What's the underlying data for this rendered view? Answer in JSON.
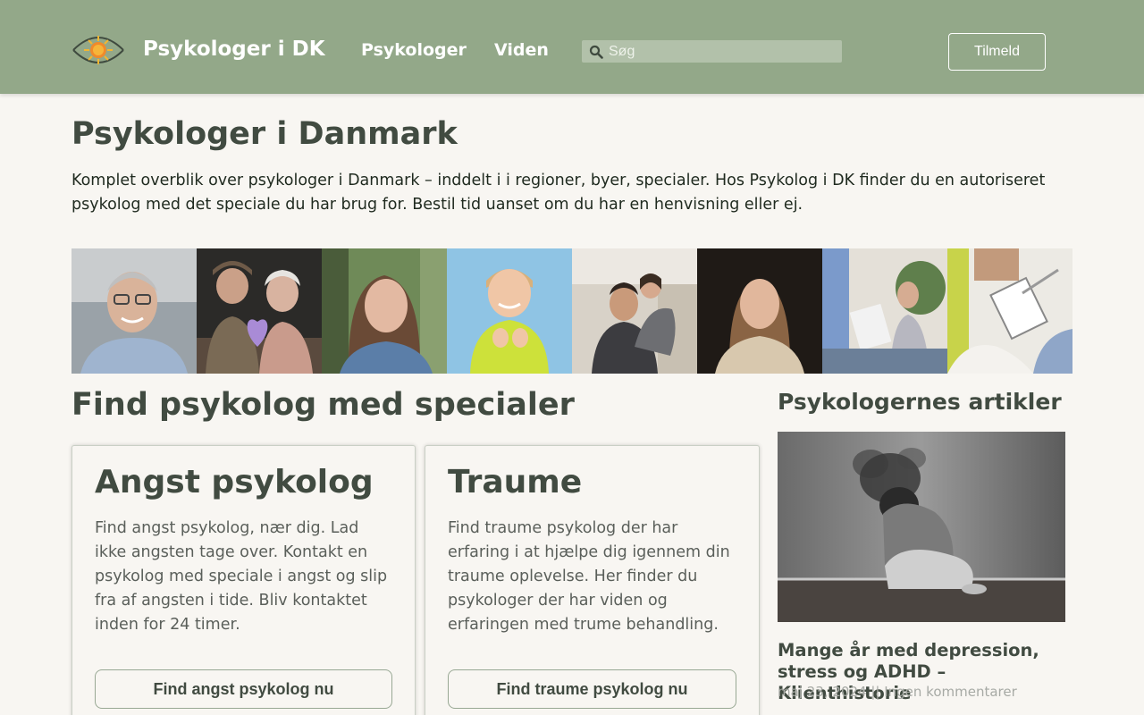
{
  "header": {
    "site_title": "Psykologer i DK",
    "nav": [
      {
        "label": "Psykologer"
      },
      {
        "label": "Viden"
      }
    ],
    "search": {
      "placeholder": "Søg",
      "value": ""
    },
    "signup_label": "Tilmeld"
  },
  "intro": {
    "title": "Psykologer i Danmark",
    "text": "Komplet overblik over psykologer i Danmark – inddelt i i regioner, byer, specialer. Hos Psykolog i DK finder du en autoriseret psykolog med det speciale du har brug for. Bestil tid uanset om du har en henvisning eller ej."
  },
  "photo_strip": [
    {
      "icon": "smiling-older-man-photo"
    },
    {
      "icon": "elderly-couple-heart-balloon-photo"
    },
    {
      "icon": "young-woman-photo"
    },
    {
      "icon": "child-yellow-shirt-photo"
    },
    {
      "icon": "happy-couple-photo"
    },
    {
      "icon": "woman-portrait-photo"
    },
    {
      "icon": "therapy-session-photo"
    },
    {
      "icon": "therapist-clipboard-photo"
    }
  ],
  "specialties": {
    "title": "Find psykolog med specialer",
    "cards": [
      {
        "title": "Angst psykolog",
        "text": "Find angst psykolog, nær dig. Lad ikke angsten tage over. Kontakt en psykolog med speciale i angst og slip fra af angsten i tide. Bliv kontaktet inden for 24 timer.",
        "button": "Find angst psykolog nu"
      },
      {
        "title": "Traume",
        "text": "Find traume psykolog der har erfaring i at hjælpe dig igennem din traume oplevelse. Her finder du psykologer der har viden og erfaringen med trume behandling.",
        "button": "Find traume psykolog nu"
      }
    ]
  },
  "articles": {
    "title": "Psykologernes artikler",
    "items": [
      {
        "image": "person-dissolving-smoke-photo",
        "title": "Mange år med depression, stress og ADHD – Klienthistorie",
        "date": "maj 23, 2024",
        "separator": "||",
        "comments": "Ingen kommentarer"
      }
    ]
  },
  "colors": {
    "header_bg": "#93a889",
    "page_bg": "#f8f6f2",
    "heading": "#414b41",
    "search_bg": "#b2c1aa"
  }
}
